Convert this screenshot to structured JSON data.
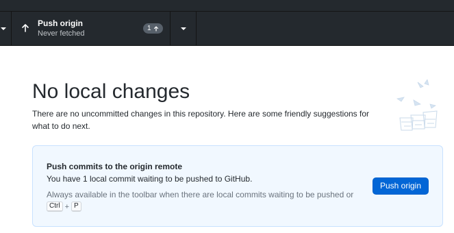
{
  "toolbar": {
    "push": {
      "title": "Push origin",
      "subtitle": "Never fetched",
      "ahead_count": "1",
      "ahead_icon": "arrow-up-icon"
    }
  },
  "main": {
    "heading": "No local changes",
    "intro": "There are no uncommitted changes in this repository. Here are some friendly suggestions for what to do next.",
    "suggestion": {
      "title": "Push commits to the origin remote",
      "description": "You have 1 local commit waiting to be pushed to GitHub.",
      "hint": "Always available in the toolbar when there are local commits waiting to be pushed or",
      "shortcut": {
        "key1": "Ctrl",
        "plus": "+",
        "key2": "P"
      },
      "button_label": "Push origin"
    }
  },
  "colors": {
    "toolbar_bg": "#24292e",
    "accent": "#0366d6",
    "suggestion_bg": "#f1f8ff",
    "suggestion_border": "#c8e1ff"
  }
}
